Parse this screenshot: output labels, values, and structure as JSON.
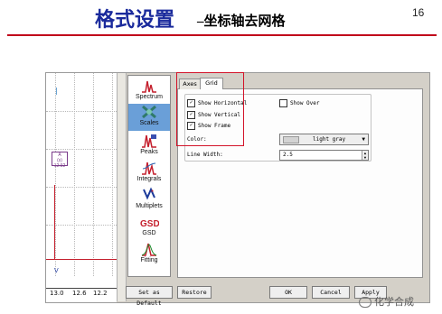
{
  "slide": {
    "title_main": "格式设置",
    "title_sub": "–坐标轴去网格",
    "page_number": "16",
    "watermark": "化学合成"
  },
  "spectrum": {
    "axis_ticks": [
      "13.0",
      "12.6",
      "12.2"
    ],
    "peak_label": [
      "A",
      "(s)",
      "12.92"
    ],
    "marker": "V"
  },
  "left_panel": {
    "items": [
      {
        "label": "Spectrum",
        "icon": "spectrum-icon",
        "selected": false
      },
      {
        "label": "Scales",
        "icon": "scales-icon",
        "selected": true
      },
      {
        "label": "Peaks",
        "icon": "peaks-icon",
        "selected": false
      },
      {
        "label": "Integrals",
        "icon": "integrals-icon",
        "selected": false
      },
      {
        "label": "Multiplets",
        "icon": "multiplets-icon",
        "selected": false
      },
      {
        "label": "GSD",
        "icon": "gsd-icon",
        "selected": false
      },
      {
        "label": "Fitting",
        "icon": "fitting-icon",
        "selected": false
      }
    ]
  },
  "tabs": {
    "axes": "Axes",
    "grid": "Grid"
  },
  "grid_options": {
    "show_horizontal": {
      "label": "Show Horizontal",
      "checked": true
    },
    "show_vertical": {
      "label": "Show Vertical",
      "checked": true
    },
    "show_frame": {
      "label": "Show Frame",
      "checked": true
    },
    "show_over": {
      "label": "Show Over",
      "checked": false
    },
    "color_label": "Color:",
    "color_value": "light gray",
    "line_width_label": "Line Width:",
    "line_width_value": "2.5"
  },
  "buttons": {
    "set_default": "Set as Default",
    "restore": "Restore",
    "ok": "OK",
    "cancel": "Cancel",
    "apply": "Apply"
  },
  "colors": {
    "title_blue": "#1a2a9c",
    "accent_red": "#c0001a",
    "highlight_box": "#d3142a",
    "selected_item": "#6a9fd8"
  }
}
